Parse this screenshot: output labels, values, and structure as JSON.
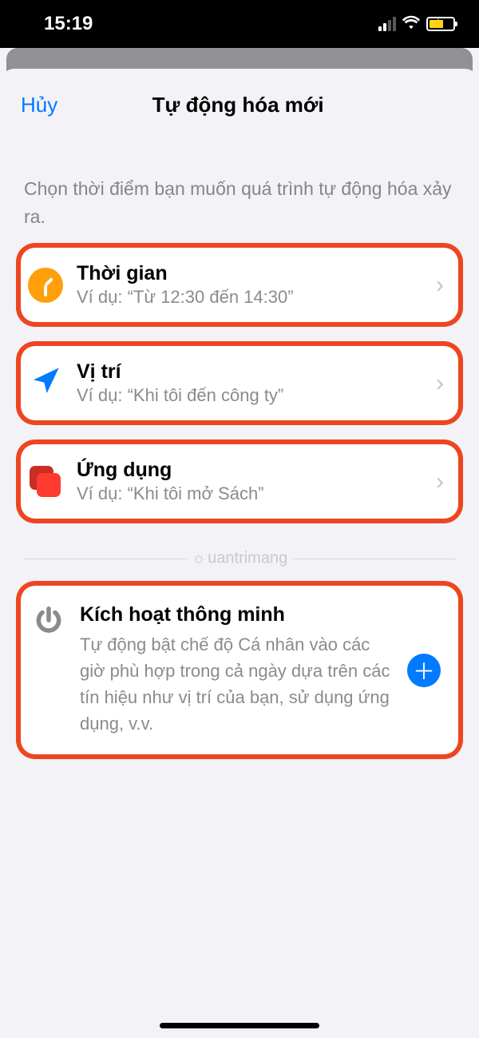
{
  "status": {
    "time": "15:19"
  },
  "nav": {
    "cancel": "Hủy",
    "title": "Tự động hóa mới"
  },
  "description": "Chọn thời điểm bạn muốn quá trình tự động hóa xảy ra.",
  "options": [
    {
      "title": "Thời gian",
      "subtitle": "Ví dụ: “Từ 12:30 đến 14:30”"
    },
    {
      "title": "Vị trí",
      "subtitle": "Ví dụ: “Khi tôi đến công ty”"
    },
    {
      "title": "Ứng dụng",
      "subtitle": "Ví dụ: “Khi tôi mở Sách”"
    }
  ],
  "watermark": "uantrimang",
  "smart": {
    "title": "Kích hoạt thông minh",
    "desc": "Tự động bật chế độ Cá nhân vào các giờ phù hợp trong cả ngày dựa trên các tín hiệu như vị trí của bạn, sử dụng ứng dụng, v.v."
  }
}
